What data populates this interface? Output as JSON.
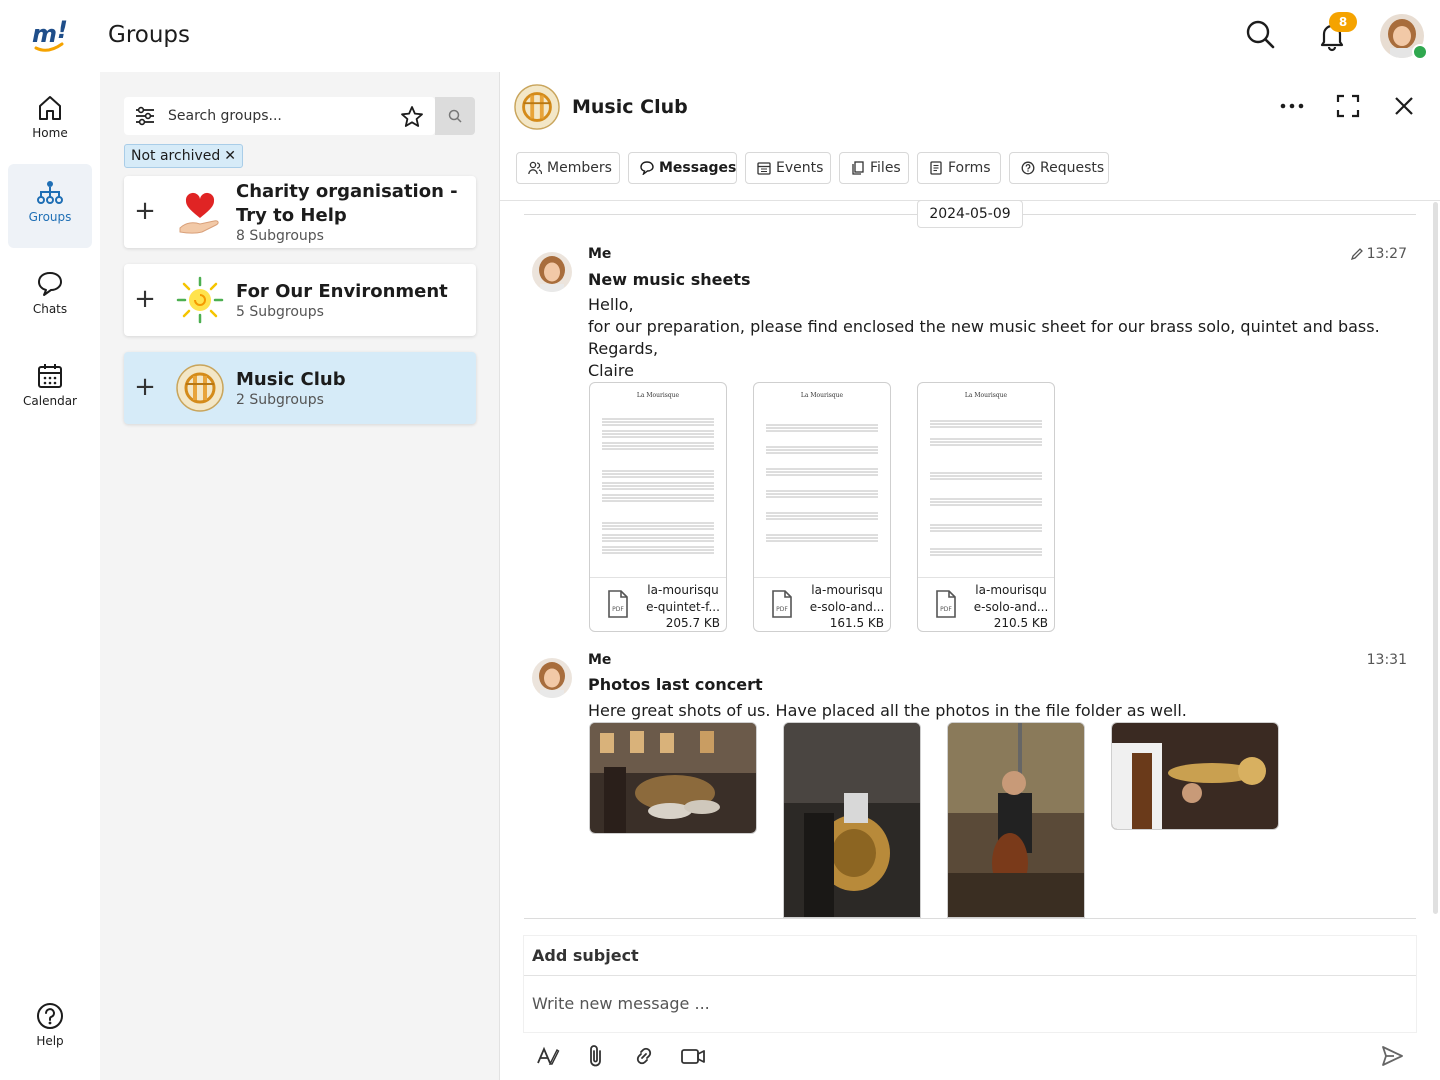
{
  "app": {
    "title": "Groups",
    "notification_count": "8"
  },
  "nav": {
    "items": [
      {
        "label": "Home"
      },
      {
        "label": "Groups"
      },
      {
        "label": "Chats"
      },
      {
        "label": "Calendar"
      },
      {
        "label": "Help"
      }
    ]
  },
  "groups_panel": {
    "search_placeholder": "Search groups...",
    "filter_chip": "Not archived",
    "groups": [
      {
        "name": "Charity organisation - Try to Help",
        "subgroups": "8 Subgroups"
      },
      {
        "name": "For Our Environment",
        "subgroups": "5 Subgroups"
      },
      {
        "name": "Music Club",
        "subgroups": "2 Subgroups"
      }
    ]
  },
  "chat": {
    "title": "Music Club",
    "tabs": [
      {
        "label": "Members"
      },
      {
        "label": "Messages"
      },
      {
        "label": "Events"
      },
      {
        "label": "Files"
      },
      {
        "label": "Forms"
      },
      {
        "label": "Requests"
      }
    ],
    "date_separator": "2024-05-09",
    "messages": [
      {
        "sender": "Me",
        "time": "13:27",
        "subject": "New music sheets",
        "body": [
          "Hello,",
          "for our preparation, please find enclosed the new music sheet for our brass solo, quintet and bass.",
          "Regards,",
          "Claire"
        ],
        "attachments": [
          {
            "name_line1": "la-mourisqu",
            "name_line2": "e-quintet-f...",
            "size": "205.7 KB",
            "thumb_title": "La Mourisque"
          },
          {
            "name_line1": "la-mourisqu",
            "name_line2": "e-solo-and...",
            "size": "161.5 KB",
            "thumb_title": "La Mourisque"
          },
          {
            "name_line1": "la-mourisqu",
            "name_line2": "e-solo-and...",
            "size": "210.5 KB",
            "thumb_title": "La Mourisque"
          }
        ]
      },
      {
        "sender": "Me",
        "time": "13:31",
        "subject": "Photos last concert",
        "body": [
          "Here great shots of us. Have placed all the photos in the file folder as well."
        ]
      }
    ]
  },
  "composer": {
    "subject_placeholder": "Add subject",
    "message_placeholder": "Write new message ..."
  },
  "colors": {
    "accent": "#1f6fb5",
    "badge": "#f5a300",
    "selected_bg": "#d6ebf8",
    "online": "#2fa84f"
  },
  "icons": [
    "search-icon",
    "bell-icon",
    "home-icon",
    "groups-icon",
    "chat-icon",
    "calendar-icon",
    "help-icon",
    "filter-icon",
    "star-icon",
    "more-icon",
    "expand-icon",
    "close-icon",
    "pencil-icon",
    "pdf-icon",
    "text-format-icon",
    "attach-icon",
    "link-icon",
    "video-icon",
    "send-icon"
  ]
}
